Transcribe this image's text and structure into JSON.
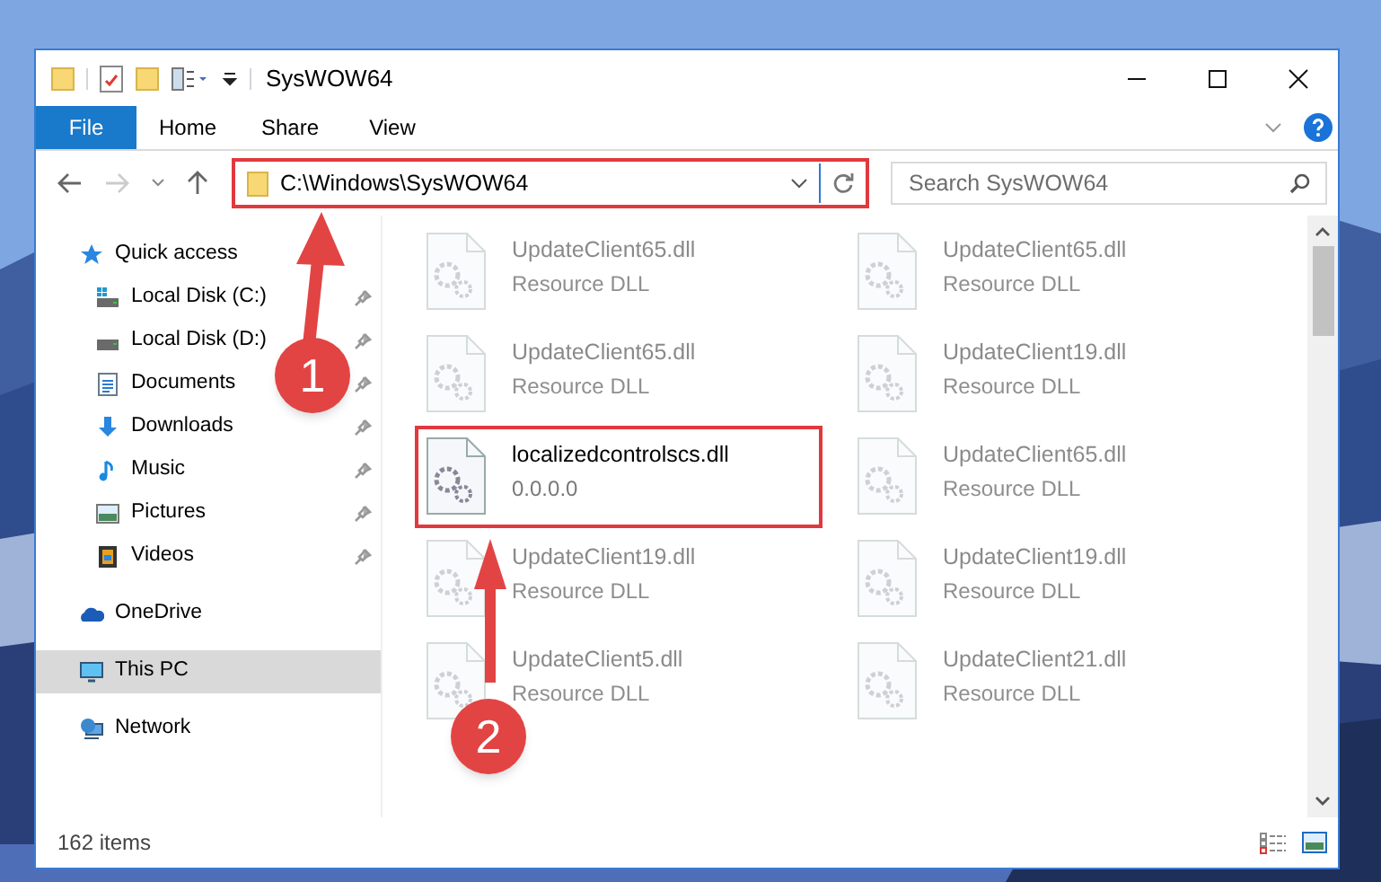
{
  "window": {
    "title": "SysWOW64"
  },
  "ribbon_tabs": [
    {
      "label": "File",
      "kind": "file"
    },
    {
      "label": "Home",
      "kind": "tab"
    },
    {
      "label": "Share",
      "kind": "tab"
    },
    {
      "label": "View",
      "kind": "tab"
    }
  ],
  "address": {
    "path": "C:\\Windows\\SysWOW64",
    "highlighted": true
  },
  "search": {
    "placeholder": "Search SysWOW64"
  },
  "nav": [
    {
      "label": "Quick access",
      "selected": false,
      "children": [
        {
          "label": "Local Disk (C:)",
          "pinned": true,
          "selected": false
        },
        {
          "label": "Local Disk (D:)",
          "pinned": true,
          "selected": false
        },
        {
          "label": "Documents",
          "pinned": true,
          "selected": false
        },
        {
          "label": "Downloads",
          "pinned": true,
          "selected": false
        },
        {
          "label": "Music",
          "pinned": true,
          "selected": false
        },
        {
          "label": "Pictures",
          "pinned": true,
          "selected": false
        },
        {
          "label": "Videos",
          "pinned": true,
          "selected": false
        }
      ]
    },
    {
      "label": "OneDrive",
      "selected": false
    },
    {
      "label": "This PC",
      "selected": true
    },
    {
      "label": "Network",
      "selected": false
    }
  ],
  "files": [
    {
      "name": "UpdateClient65.dll",
      "detail": "Resource DLL",
      "faded": true,
      "highlighted": false
    },
    {
      "name": "UpdateClient65.dll",
      "detail": "Resource DLL",
      "faded": true,
      "highlighted": false
    },
    {
      "name": "UpdateClient65.dll",
      "detail": "Resource DLL",
      "faded": true,
      "highlighted": false
    },
    {
      "name": "UpdateClient19.dll",
      "detail": "Resource DLL",
      "faded": true,
      "highlighted": false
    },
    {
      "name": "localizedcontrolscs.dll",
      "detail": "0.0.0.0",
      "faded": false,
      "highlighted": true
    },
    {
      "name": "UpdateClient65.dll",
      "detail": "Resource DLL",
      "faded": true,
      "highlighted": false
    },
    {
      "name": "UpdateClient19.dll",
      "detail": "Resource DLL",
      "faded": true,
      "highlighted": false
    },
    {
      "name": "UpdateClient19.dll",
      "detail": "Resource DLL",
      "faded": true,
      "highlighted": false
    },
    {
      "name": "UpdateClient5.dll",
      "detail": "Resource DLL",
      "faded": true,
      "highlighted": false
    },
    {
      "name": "UpdateClient21.dll",
      "detail": "Resource DLL",
      "faded": true,
      "highlighted": false
    }
  ],
  "status_bar": {
    "count": "162 items"
  },
  "callouts": [
    {
      "number": "1"
    },
    {
      "number": "2"
    }
  ]
}
